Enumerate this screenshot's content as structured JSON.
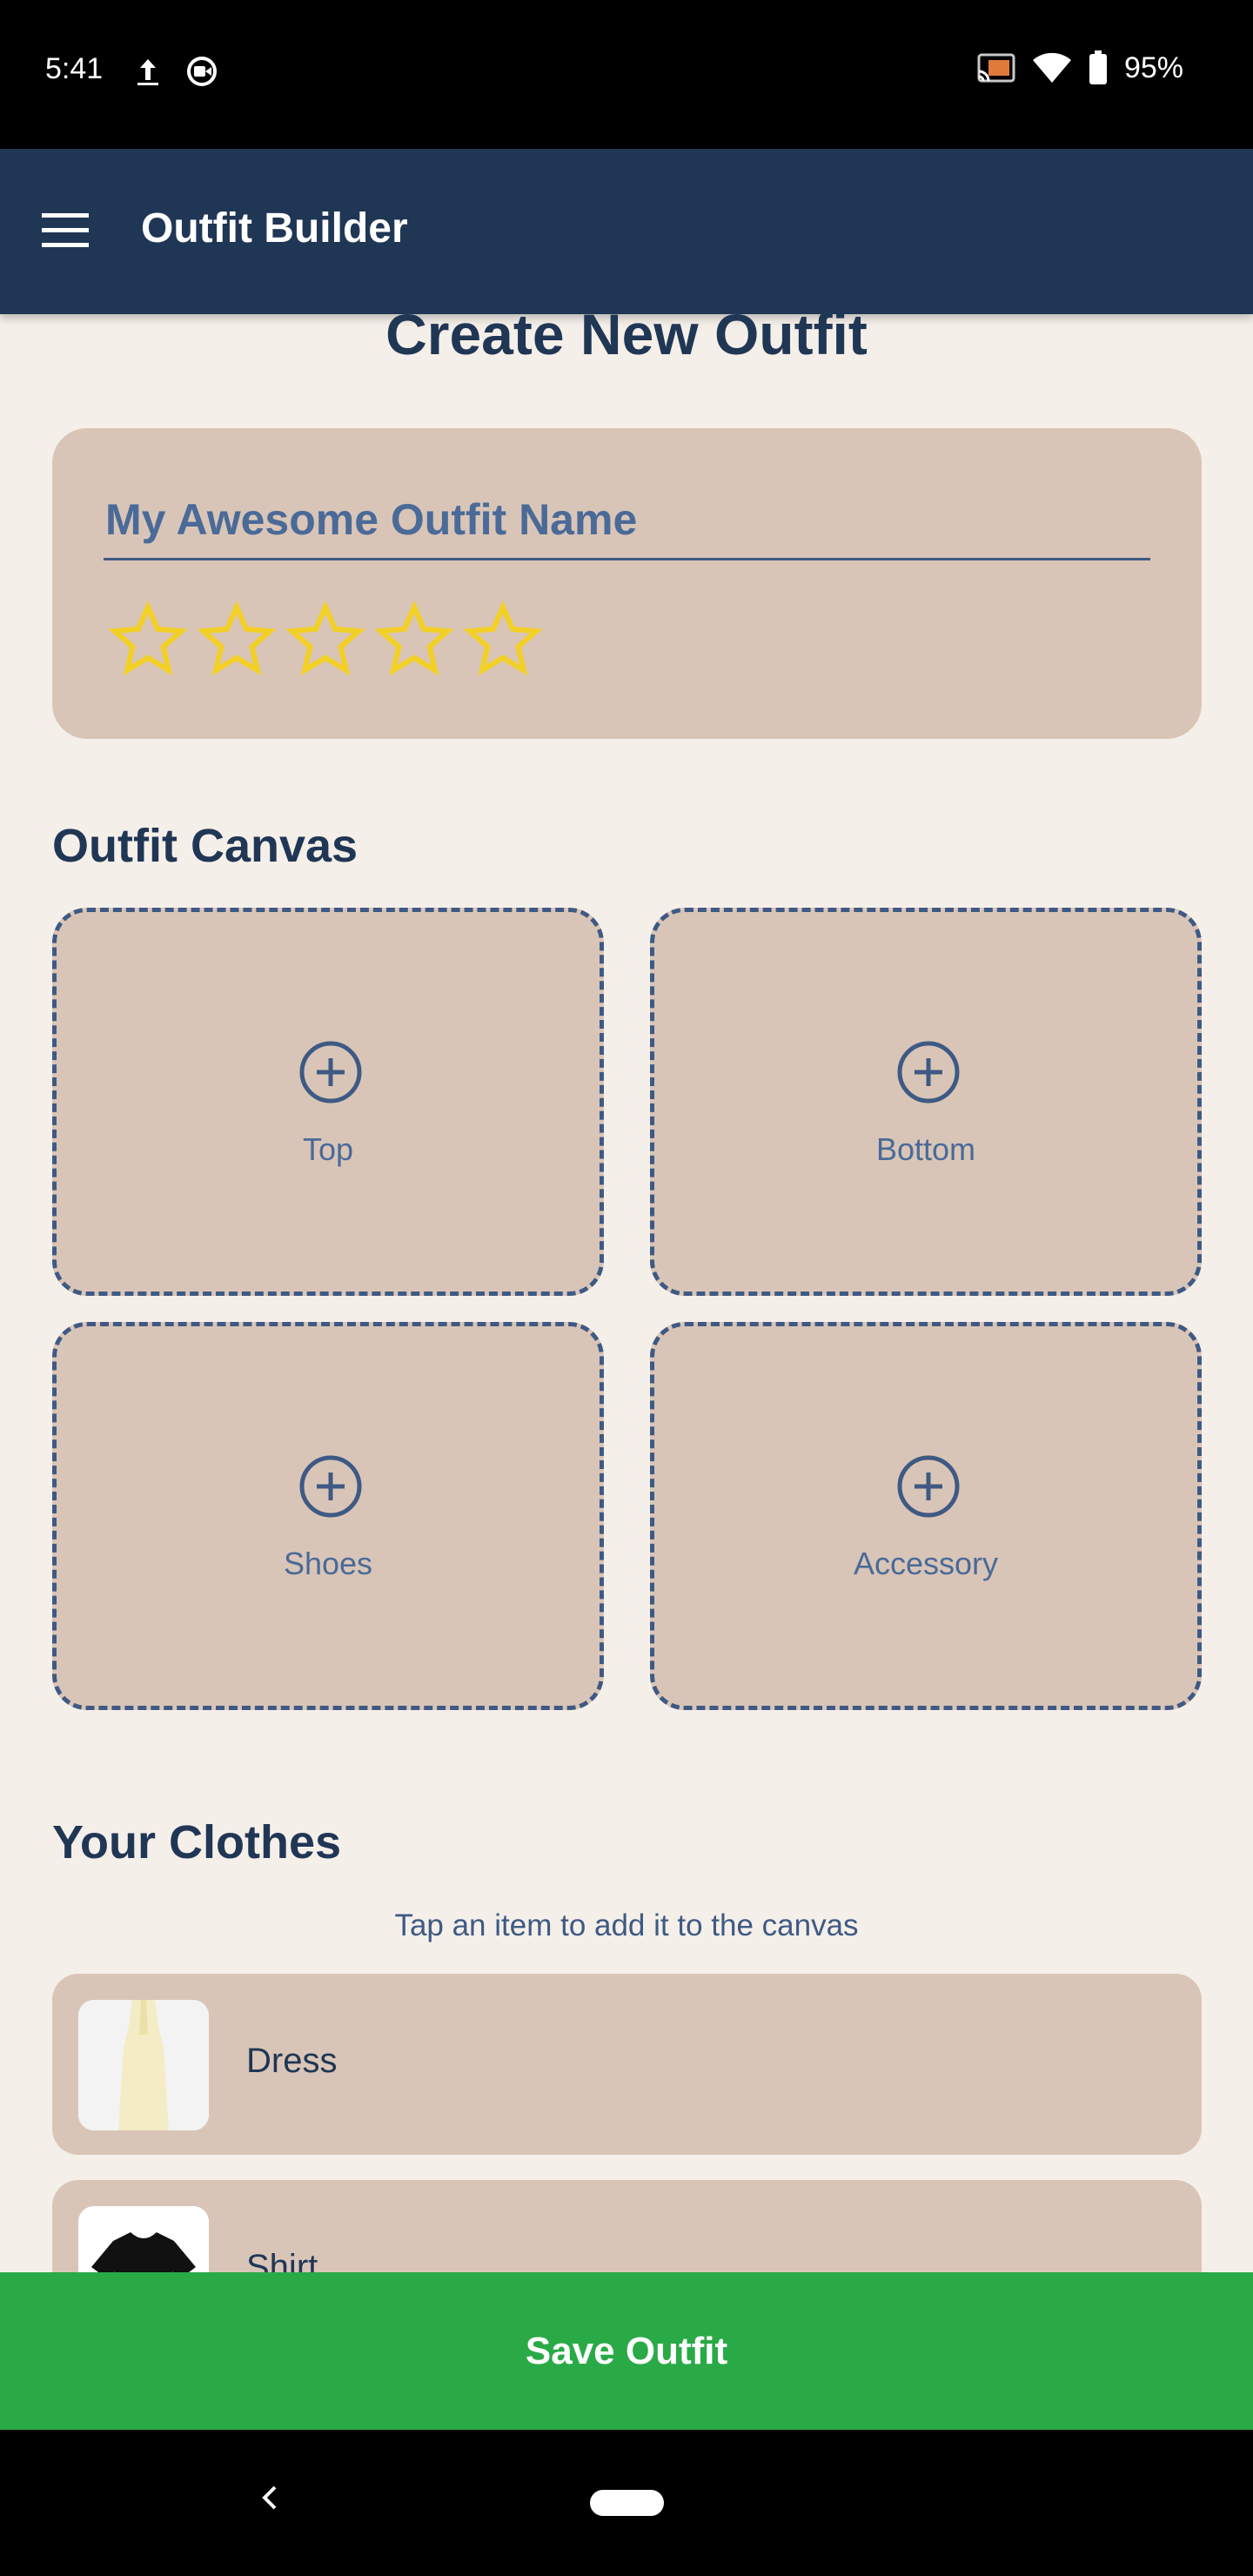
{
  "status_bar": {
    "time": "5:41",
    "battery": "95%",
    "icons": [
      "upload-icon",
      "screen-record-icon",
      "cast-icon",
      "wifi-icon",
      "battery-icon"
    ]
  },
  "app_bar": {
    "title": "Outfit Builder",
    "menu_icon": "hamburger-menu-icon"
  },
  "page": {
    "title": "Create New Outfit"
  },
  "name_card": {
    "outfit_name_value": "My Awesome Outfit Name",
    "rating": {
      "value": 0,
      "max": 5,
      "star_color": "#f2d026"
    }
  },
  "canvas": {
    "title": "Outfit Canvas",
    "slots": [
      {
        "label": "Top",
        "icon": "add-circle-icon"
      },
      {
        "label": "Bottom",
        "icon": "add-circle-icon"
      },
      {
        "label": "Shoes",
        "icon": "add-circle-icon"
      },
      {
        "label": "Accessory",
        "icon": "add-circle-icon"
      }
    ]
  },
  "clothes": {
    "title": "Your Clothes",
    "hint": "Tap an item to add it to the canvas",
    "items": [
      {
        "name": "Dress",
        "thumb": "dress-image"
      },
      {
        "name": "Shirt",
        "thumb": "shirt-image"
      }
    ]
  },
  "actions": {
    "save_label": "Save Outfit"
  },
  "colors": {
    "primary": "#203655",
    "background": "#f5efe9",
    "card": "#d9c5b7",
    "save": "#2aaa46",
    "accent": "#3e5a84"
  }
}
